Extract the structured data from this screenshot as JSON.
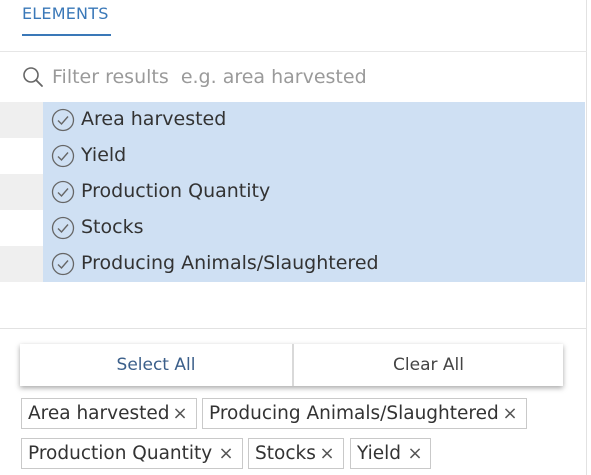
{
  "tabs": {
    "active_label": "ELEMENTS"
  },
  "search": {
    "placeholder": "Filter results  e.g. area harvested",
    "value": ""
  },
  "elements": [
    {
      "label": "Area harvested",
      "selected": true
    },
    {
      "label": "Yield",
      "selected": true
    },
    {
      "label": "Production Quantity",
      "selected": true
    },
    {
      "label": "Stocks",
      "selected": true
    },
    {
      "label": "Producing Animals/Slaughtered",
      "selected": true
    }
  ],
  "actions": {
    "select_all_label": "Select All",
    "clear_all_label": "Clear All"
  },
  "selected_chips": [
    {
      "label": "Area harvested",
      "remove_glyph": "×"
    },
    {
      "label": "Producing Animals/Slaughtered",
      "remove_glyph": "×"
    },
    {
      "label": "Production Quantity",
      "remove_glyph": "×"
    },
    {
      "label": "Stocks",
      "remove_glyph": "×"
    },
    {
      "label": "Yield",
      "remove_glyph": "×"
    }
  ],
  "colors": {
    "accent": "#3a78b8",
    "selected_row": "#cfe0f3"
  }
}
